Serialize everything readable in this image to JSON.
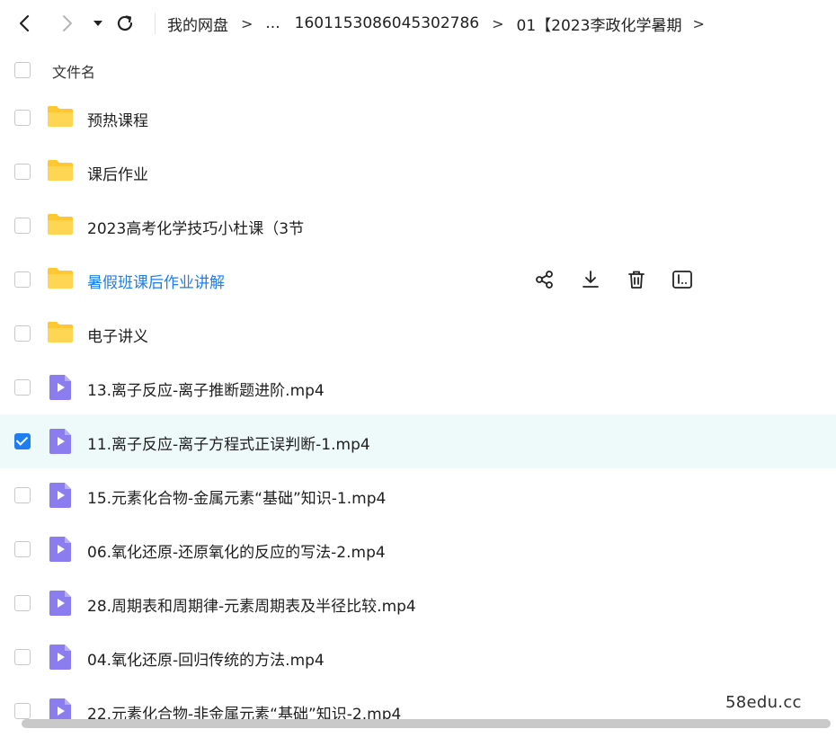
{
  "toolbar": {
    "back_icon": "chevron-left-icon",
    "forward_icon": "chevron-right-icon",
    "history_icon": "caret-down-icon",
    "refresh_icon": "refresh-icon"
  },
  "breadcrumb": [
    "我的网盘",
    "...",
    "1601153086045302786",
    "01【2023李政化学暑期"
  ],
  "breadcrumb_separator": ">",
  "header": {
    "name_label": "文件名"
  },
  "files": [
    {
      "name": "预热课程",
      "type": "folder"
    },
    {
      "name": "课后作业",
      "type": "folder"
    },
    {
      "name": "2023高考化学技巧小杜课（3节",
      "type": "folder"
    },
    {
      "name": "暑假班课后作业讲解",
      "type": "folder",
      "hover": true
    },
    {
      "name": "电子讲义",
      "type": "folder"
    },
    {
      "name": "13.离子反应-离子推断题进阶.mp4",
      "type": "video"
    },
    {
      "name": "11.离子反应-离子方程式正误判断-1.mp4",
      "type": "video",
      "selected": true
    },
    {
      "name": "15.元素化合物-金属元素“基础”知识-1.mp4",
      "type": "video"
    },
    {
      "name": "06.氧化还原-还原氧化的反应的写法-2.mp4",
      "type": "video"
    },
    {
      "name": "28.周期表和周期律-元素周期表及半径比较.mp4",
      "type": "video"
    },
    {
      "name": "04.氧化还原-回归传统的方法.mp4",
      "type": "video"
    },
    {
      "name": "22.元素化合物-非金属元素“基础”知识-2.mp4",
      "type": "video"
    }
  ],
  "row_actions": [
    "share-icon",
    "download-icon",
    "delete-icon",
    "rename-icon"
  ],
  "watermark": "58edu.cc",
  "colors": {
    "accent": "#1e7ef0",
    "folder": "#ffc832",
    "video": "#8b7cf0",
    "selected_row": "#eefaf9"
  }
}
